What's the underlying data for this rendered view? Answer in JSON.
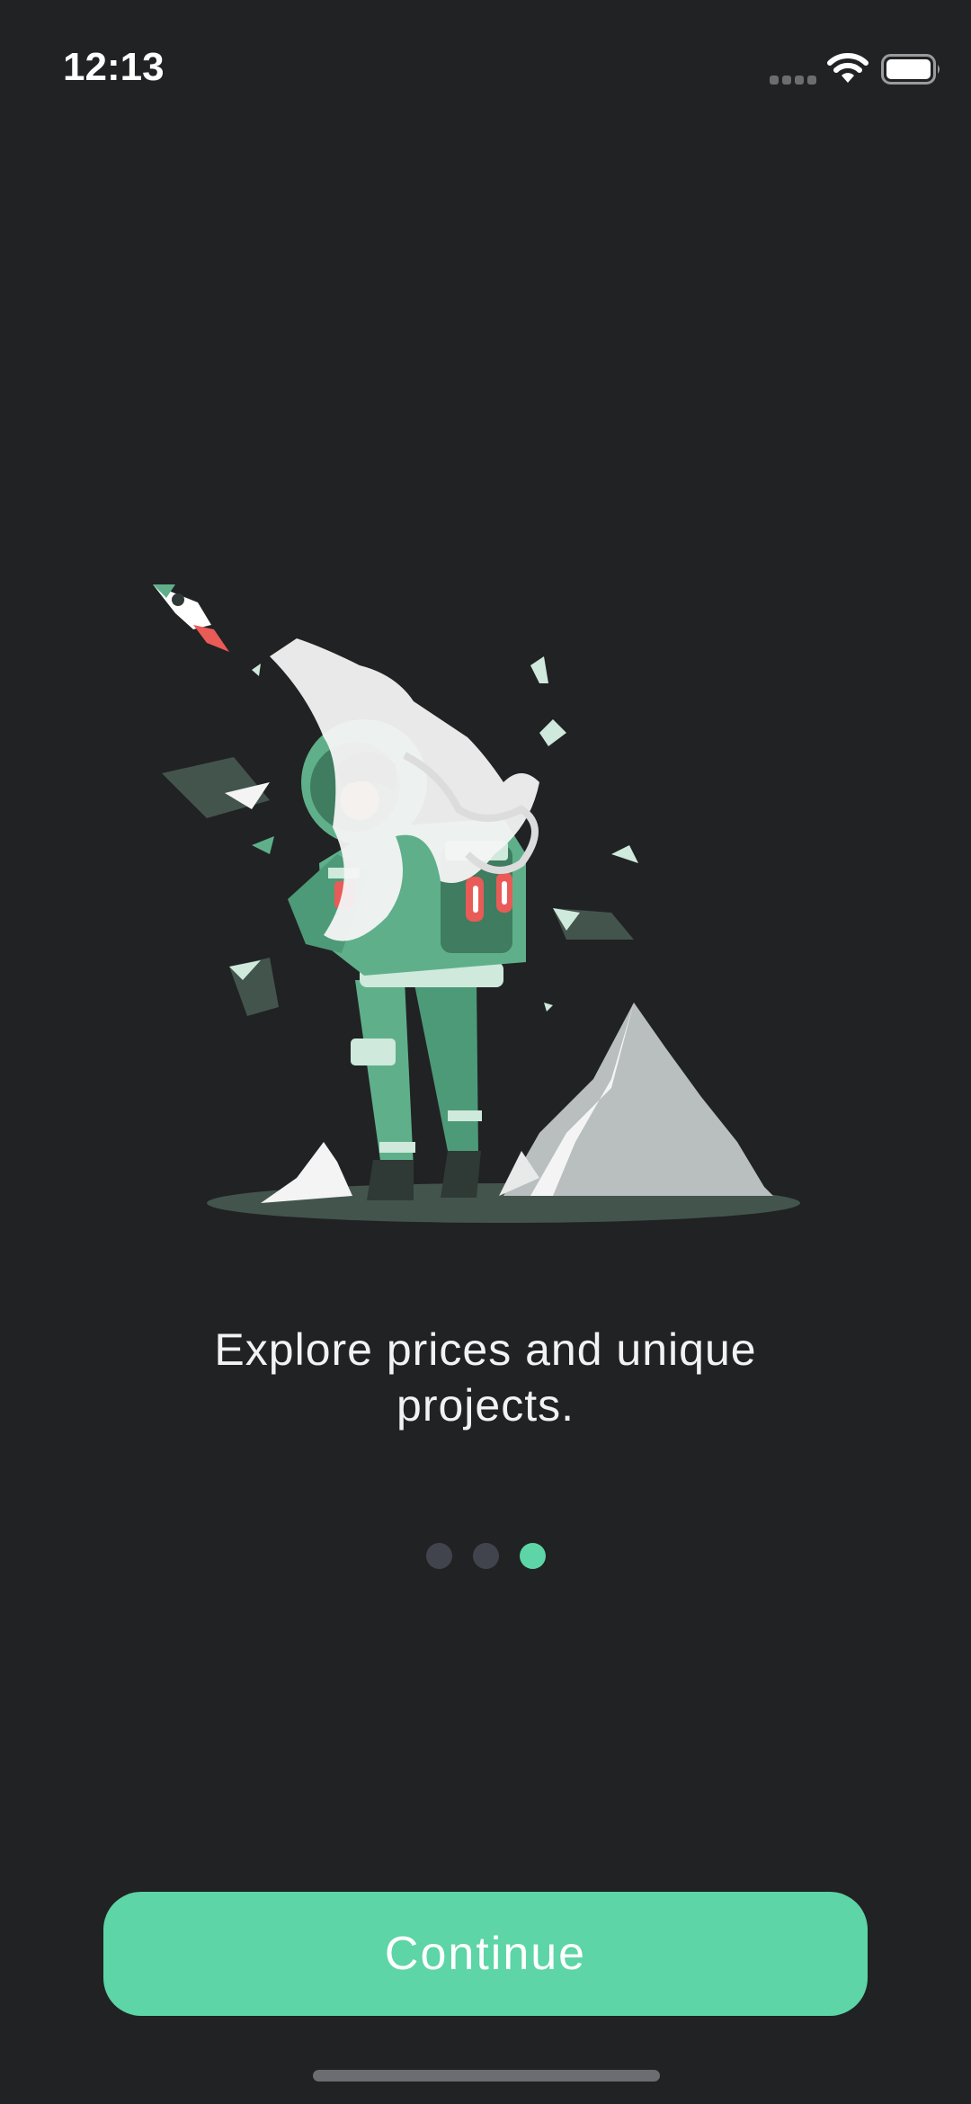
{
  "status_bar": {
    "time": "12:13",
    "signal_icon": "signal-dots-icon",
    "wifi_icon": "wifi-icon",
    "battery_icon": "battery-icon"
  },
  "illustration": {
    "name": "astronaut-illustration",
    "colors": {
      "suit": "#5fb08a",
      "suit_dark": "#3f7c60",
      "smoke": "#f4f4f4",
      "rock": "#b8bfbe",
      "ground": "#43544c"
    }
  },
  "onboarding": {
    "caption_line1": "Explore prices and unique",
    "caption_line2": "projects.",
    "page_count": 3,
    "active_page": 3
  },
  "actions": {
    "continue_label": "Continue"
  },
  "colors": {
    "background": "#212224",
    "accent": "#5dd5a6",
    "dot_inactive": "#41444d",
    "text": "#f2f2f2"
  }
}
